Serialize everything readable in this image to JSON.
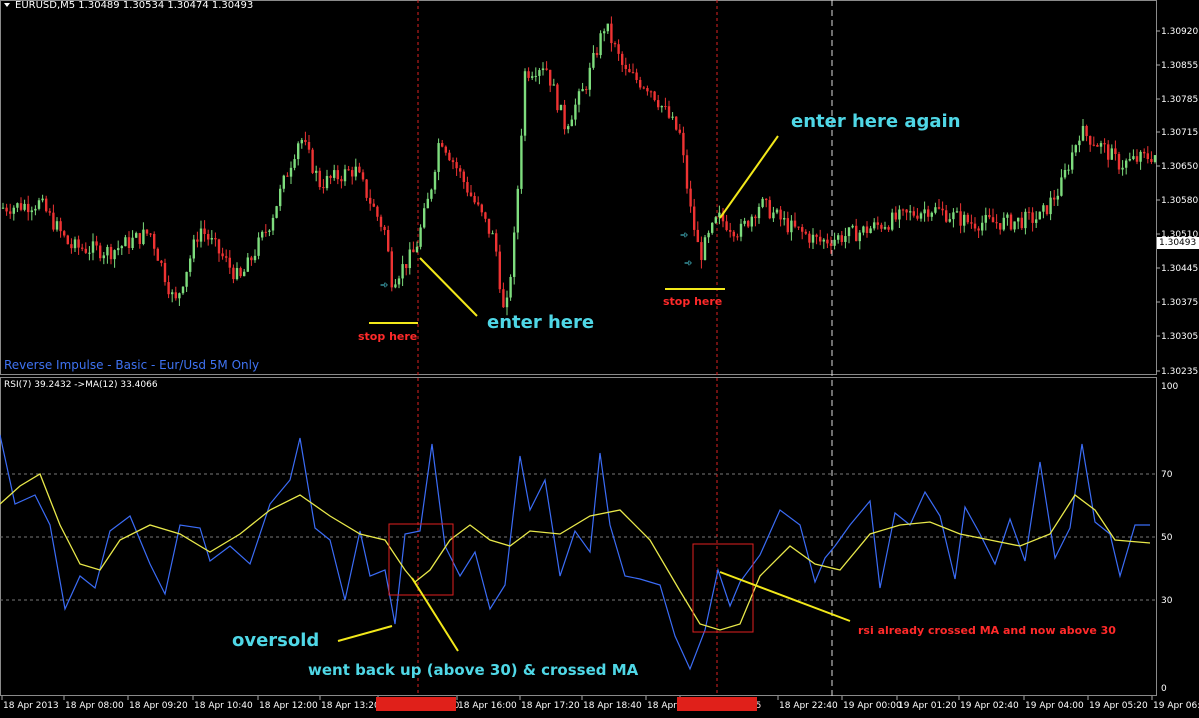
{
  "symbol_header": "EURUSD,M5  1.30489 1.30534 1.30474 1.30493",
  "indicator_name": "Reverse Impulse - Basic - Eur/Usd 5M Only",
  "rsi_header": "RSI(7) 39.2432  ->MA(12) 33.4066",
  "colors": {
    "background": "#000000",
    "bull_candle": "#7ddc7d",
    "bear_candle": "#ee3333",
    "rsi_line": "#3b6cf6",
    "ma_line": "#e8e84a",
    "annotation_cyan": "#4fd7e6",
    "annotation_red": "#ff2a2a",
    "pointer_line": "#f2e81a",
    "grid_line": "#7f7f7f"
  },
  "price_axis": {
    "ticks": [
      "1.30920",
      "1.30855",
      "1.30785",
      "1.30715",
      "1.30650",
      "1.30580",
      "1.30510",
      "1.30445",
      "1.30375",
      "1.30305",
      "1.30235"
    ],
    "current_price": "1.30493"
  },
  "rsi_axis": {
    "ticks": [
      "100",
      "70",
      "50",
      "30",
      "0"
    ]
  },
  "time_axis": {
    "labels": [
      "18 Apr 2013",
      "18 Apr 08:00",
      "18 Apr 09:20",
      "18 Apr 10:40",
      "18 Apr 12:00",
      "18 Apr 13:20",
      "2013.04.18 15:20",
      "18 Apr 16:00",
      "18 Apr 17:20",
      "18 Apr 18:40",
      "18 Apr 2",
      "2013.04.18 21:35",
      "18 Apr 22:40",
      "19 Apr 00:00",
      "19 Apr 01:20",
      "19 Apr 02:40",
      "19 Apr 04:00",
      "19 Apr 05:20",
      "19 Apr 06:4"
    ],
    "highlighted": [
      "2013.04.18 15:20",
      "2013.04.18 21:35"
    ]
  },
  "annotations": {
    "enter_here": "enter here",
    "enter_here_again": "enter here again",
    "stop_here_1": "stop here",
    "stop_here_2": "stop here",
    "oversold": "oversold",
    "went_back_up": "went back up (above 30) & crossed MA",
    "rsi_crossed": "rsi already crossed MA and now above 30"
  },
  "chart_data": [
    {
      "type": "candlestick",
      "title": "EURUSD,M5  1.30489 1.30534 1.30474 1.30493",
      "ylim": [
        1.3021,
        1.3096
      ],
      "close_path": [
        [
          0,
          1.3055
        ],
        [
          40,
          1.3056
        ],
        [
          70,
          1.3047
        ],
        [
          110,
          1.3046
        ],
        [
          150,
          1.305
        ],
        [
          175,
          1.3035
        ],
        [
          200,
          1.3051
        ],
        [
          240,
          1.304
        ],
        [
          270,
          1.3052
        ],
        [
          300,
          1.307
        ],
        [
          320,
          1.306
        ],
        [
          355,
          1.3063
        ],
        [
          385,
          1.305
        ],
        [
          392,
          1.304
        ],
        [
          415,
          1.3046
        ],
        [
          430,
          1.3058
        ],
        [
          440,
          1.307
        ],
        [
          470,
          1.3058
        ],
        [
          495,
          1.3048
        ],
        [
          505,
          1.3031
        ],
        [
          515,
          1.305
        ],
        [
          525,
          1.3083
        ],
        [
          545,
          1.3085
        ],
        [
          565,
          1.3072
        ],
        [
          585,
          1.308
        ],
        [
          605,
          1.3093
        ],
        [
          625,
          1.3083
        ],
        [
          650,
          1.308
        ],
        [
          680,
          1.307
        ],
        [
          690,
          1.3055
        ],
        [
          700,
          1.3045
        ],
        [
          718,
          1.3053
        ],
        [
          740,
          1.305
        ],
        [
          760,
          1.3056
        ],
        [
          790,
          1.3051
        ],
        [
          820,
          1.3048
        ],
        [
          860,
          1.305
        ],
        [
          900,
          1.3053
        ],
        [
          930,
          1.3055
        ],
        [
          970,
          1.3052
        ],
        [
          1010,
          1.3052
        ],
        [
          1040,
          1.3053
        ],
        [
          1060,
          1.3059
        ],
        [
          1080,
          1.3071
        ],
        [
          1100,
          1.3068
        ],
        [
          1120,
          1.3064
        ],
        [
          1155,
          1.3066
        ]
      ]
    },
    {
      "type": "line",
      "title": "RSI(7) 39.2432  ->MA(12) 33.4066",
      "ylim": [
        0,
        100
      ],
      "reference_levels": [
        70,
        50,
        30
      ],
      "series": [
        {
          "name": "RSI(7)",
          "color": "#3b6cf6",
          "points": [
            [
              0,
              85
            ],
            [
              15,
              62
            ],
            [
              35,
              65
            ],
            [
              50,
              55
            ],
            [
              65,
              27
            ],
            [
              80,
              38
            ],
            [
              95,
              34
            ],
            [
              110,
              53
            ],
            [
              130,
              58
            ],
            [
              150,
              42
            ],
            [
              165,
              32
            ],
            [
              180,
              55
            ],
            [
              200,
              54
            ],
            [
              210,
              43
            ],
            [
              230,
              48
            ],
            [
              250,
              42
            ],
            [
              270,
              62
            ],
            [
              290,
              70
            ],
            [
              300,
              84
            ],
            [
              315,
              54
            ],
            [
              330,
              50
            ],
            [
              345,
              30
            ],
            [
              360,
              53
            ],
            [
              370,
              38
            ],
            [
              385,
              40
            ],
            [
              395,
              22
            ],
            [
              405,
              52
            ],
            [
              420,
              53
            ],
            [
              432,
              82
            ],
            [
              445,
              48
            ],
            [
              460,
              38
            ],
            [
              475,
              46
            ],
            [
              490,
              27
            ],
            [
              505,
              35
            ],
            [
              520,
              78
            ],
            [
              530,
              60
            ],
            [
              545,
              70
            ],
            [
              560,
              38
            ],
            [
              575,
              53
            ],
            [
              590,
              46
            ],
            [
              600,
              79
            ],
            [
              610,
              55
            ],
            [
              625,
              38
            ],
            [
              640,
              37
            ],
            [
              660,
              35
            ],
            [
              675,
              18
            ],
            [
              690,
              7
            ],
            [
              705,
              20
            ],
            [
              718,
              40
            ],
            [
              730,
              28
            ],
            [
              740,
              36
            ],
            [
              760,
              45
            ],
            [
              780,
              60
            ],
            [
              800,
              55
            ],
            [
              815,
              36
            ],
            [
              825,
              44
            ],
            [
              835,
              48
            ],
            [
              850,
              55
            ],
            [
              870,
              63
            ],
            [
              880,
              34
            ],
            [
              895,
              59
            ],
            [
              910,
              55
            ],
            [
              925,
              66
            ],
            [
              940,
              58
            ],
            [
              955,
              37
            ],
            [
              965,
              61
            ],
            [
              980,
              52
            ],
            [
              995,
              42
            ],
            [
              1010,
              57
            ],
            [
              1025,
              43
            ],
            [
              1040,
              76
            ],
            [
              1055,
              44
            ],
            [
              1070,
              54
            ],
            [
              1082,
              82
            ],
            [
              1095,
              56
            ],
            [
              1110,
              52
            ],
            [
              1120,
              38
            ],
            [
              1135,
              55
            ],
            [
              1150,
              55
            ]
          ]
        },
        {
          "name": "MA(12)",
          "color": "#e8e84a",
          "points": [
            [
              0,
              62
            ],
            [
              20,
              68
            ],
            [
              40,
              72
            ],
            [
              60,
              55
            ],
            [
              80,
              42
            ],
            [
              100,
              40
            ],
            [
              120,
              50
            ],
            [
              150,
              55
            ],
            [
              180,
              52
            ],
            [
              210,
              46
            ],
            [
              240,
              52
            ],
            [
              270,
              60
            ],
            [
              300,
              65
            ],
            [
              330,
              58
            ],
            [
              360,
              52
            ],
            [
              385,
              50
            ],
            [
              405,
              40
            ],
            [
              415,
              36
            ],
            [
              430,
              40
            ],
            [
              450,
              50
            ],
            [
              470,
              55
            ],
            [
              490,
              50
            ],
            [
              510,
              48
            ],
            [
              530,
              53
            ],
            [
              560,
              52
            ],
            [
              590,
              58
            ],
            [
              620,
              60
            ],
            [
              650,
              50
            ],
            [
              680,
              33
            ],
            [
              700,
              22
            ],
            [
              720,
              20
            ],
            [
              740,
              22
            ],
            [
              760,
              38
            ],
            [
              790,
              48
            ],
            [
              815,
              42
            ],
            [
              840,
              40
            ],
            [
              870,
              52
            ],
            [
              900,
              55
            ],
            [
              930,
              56
            ],
            [
              960,
              52
            ],
            [
              990,
              50
            ],
            [
              1020,
              48
            ],
            [
              1050,
              52
            ],
            [
              1075,
              65
            ],
            [
              1095,
              60
            ],
            [
              1115,
              50
            ],
            [
              1150,
              49
            ]
          ]
        }
      ]
    }
  ]
}
